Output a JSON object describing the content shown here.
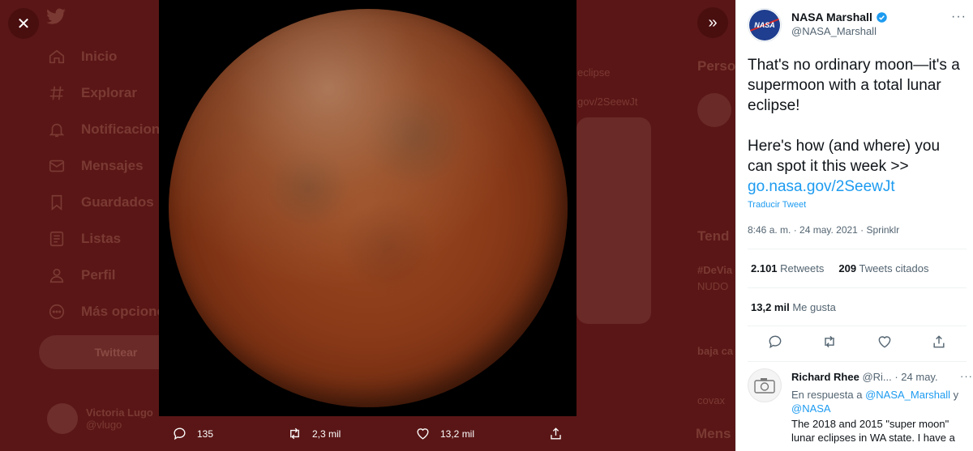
{
  "background": {
    "nav": [
      {
        "label": "Inicio",
        "icon": "home-icon"
      },
      {
        "label": "Explorar",
        "icon": "hashtag-icon"
      },
      {
        "label": "Notificaciones",
        "icon": "bell-icon"
      },
      {
        "label": "Mensajes",
        "icon": "mail-icon"
      },
      {
        "label": "Guardados",
        "icon": "bookmark-icon"
      },
      {
        "label": "Listas",
        "icon": "list-icon"
      },
      {
        "label": "Perfil",
        "icon": "person-icon"
      },
      {
        "label": "Más opciones",
        "icon": "more-circle-icon"
      }
    ],
    "tweet_button": "Twittear",
    "account": {
      "name": "Victoria Lugo",
      "handle": "@vlugo"
    },
    "side_labels": {
      "persons": "Perso",
      "eclipse": "eclipse",
      "link": "gov/2SeewJt",
      "trends": "Tend",
      "tag": "#DeVia",
      "nudo": "NUDO",
      "baja": "baja ca",
      "covax": "covax",
      "mens": "Mens"
    }
  },
  "media": {
    "actions": {
      "replies": "135",
      "retweets": "2,3 mil",
      "likes": "13,2 mil"
    }
  },
  "tweet": {
    "author_name": "NASA Marshall",
    "author_handle": "@NASA_Marshall",
    "avatar_text": "NASA",
    "text_line1": "That's no ordinary moon—it's a supermoon with a total lunar eclipse!",
    "text_line2": "Here's how (and where) you can spot it this week >>",
    "link": "go.nasa.gov/2SeewJt",
    "translate": "Traducir Tweet",
    "meta": "8:46 a. m. · 24 may. 2021 · Sprinklr",
    "retweets_count": "2.101",
    "retweets_label": "Retweets",
    "quotes_count": "209",
    "quotes_label": "Tweets citados",
    "likes_count": "13,2 mil",
    "likes_label": "Me gusta"
  },
  "reply": {
    "name": "Richard Rhee",
    "handle_date": "@Ri... · 24 may.",
    "in_reply_prefix": "En respuesta a",
    "in_reply_user1": "@NASA_Marshall",
    "in_reply_and": "y",
    "in_reply_user2": "@NASA",
    "text": "The 2018 and 2015 \"super moon\" lunar eclipses in WA state. I have a"
  },
  "colors": {
    "link": "#1d9bf0",
    "overlay": "#5a1616",
    "moon": "#8a3a18"
  }
}
